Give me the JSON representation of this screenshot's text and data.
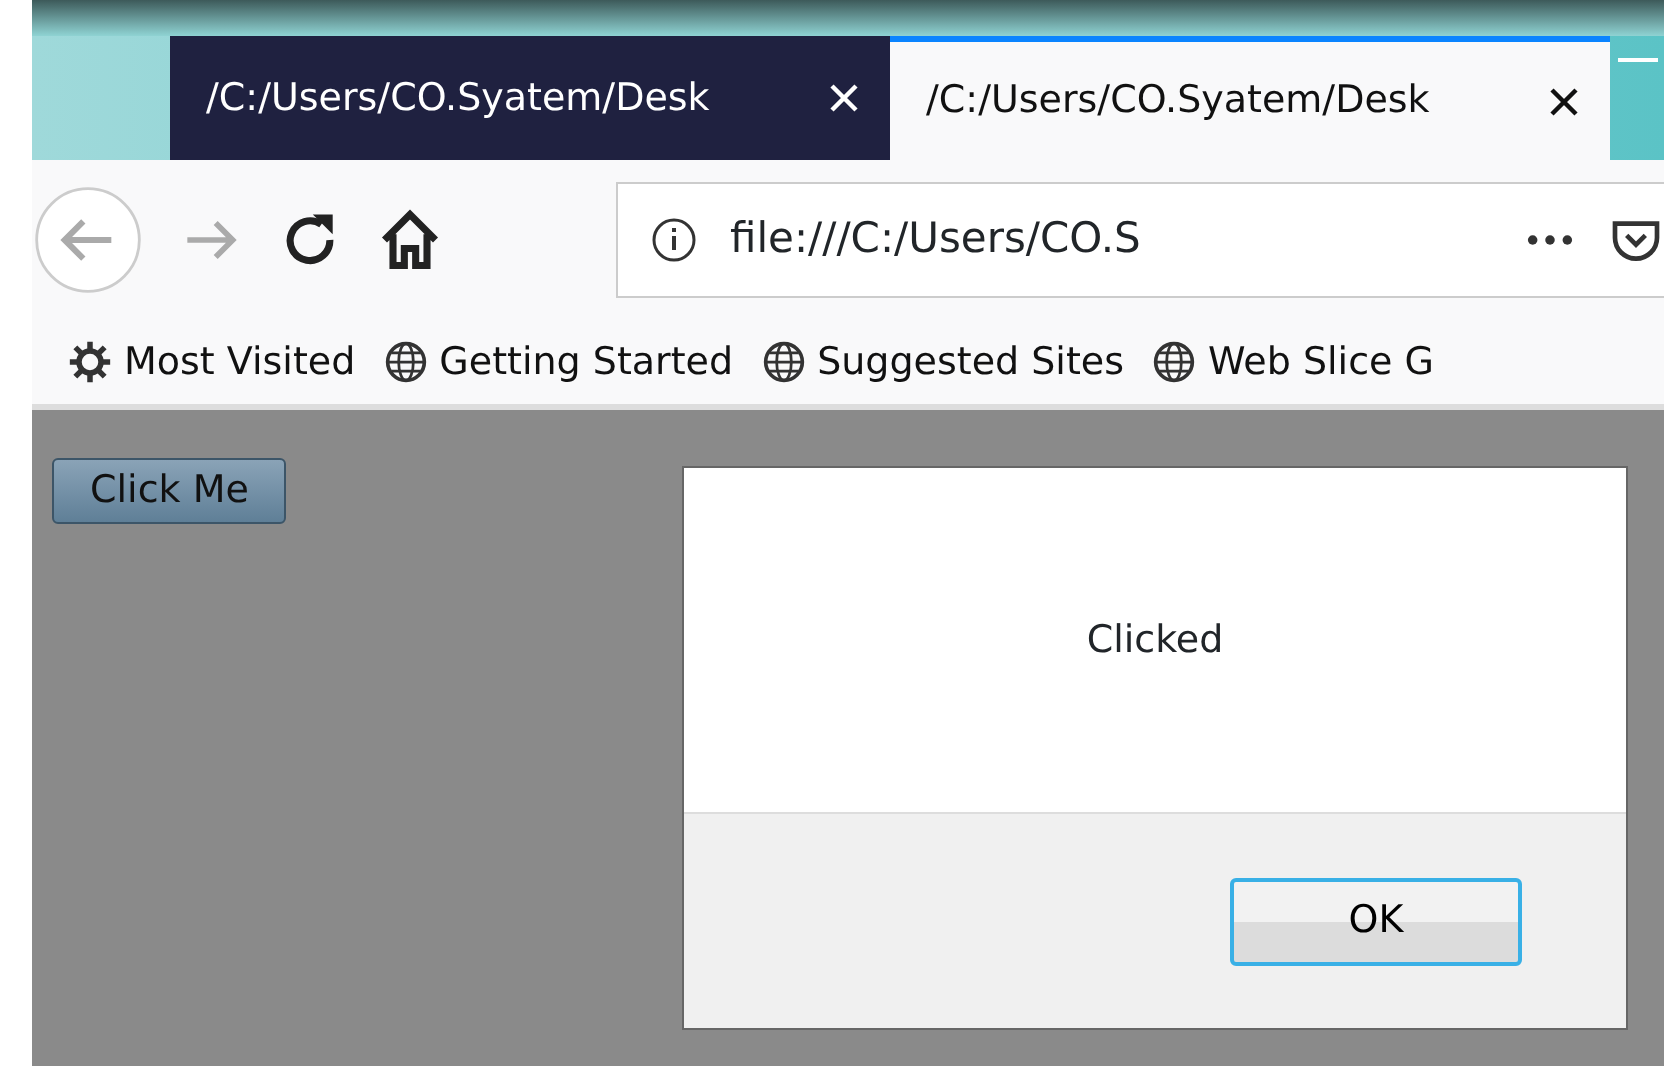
{
  "tabs": [
    {
      "title": "/C:/Users/CO.Syatem/Desk",
      "selected": false
    },
    {
      "title": "/C:/Users/CO.Syatem/Desk",
      "selected": true
    }
  ],
  "toolbar": {
    "url": "file:///C:/Users/CO.S",
    "back_disabled": true,
    "forward_disabled": true
  },
  "bookmarks": [
    {
      "label": "Most Visited",
      "kind": "gear"
    },
    {
      "label": "Getting Started",
      "kind": "globe"
    },
    {
      "label": "Suggested Sites",
      "kind": "globe"
    },
    {
      "label": "Web Slice G",
      "kind": "globe"
    }
  ],
  "page": {
    "button": "Click Me"
  },
  "dialog": {
    "message": "Clicked",
    "button": "OK"
  }
}
